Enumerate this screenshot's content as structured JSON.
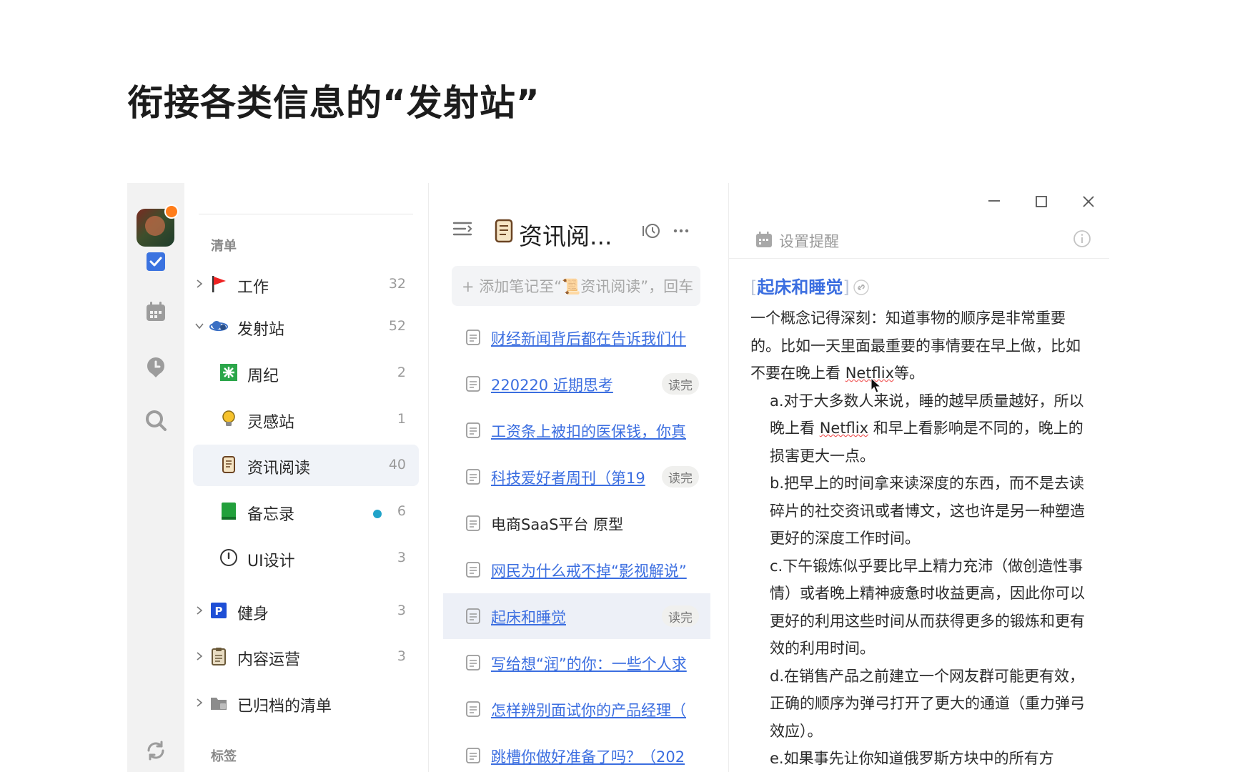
{
  "slide": {
    "title": "衔接各类信息的“发射站”"
  },
  "sidebar_rail": {
    "icons": [
      "checkbox-icon",
      "calendar-icon",
      "pin-icon",
      "search-icon",
      "sync-icon"
    ]
  },
  "lists": {
    "section_lists": "清单",
    "section_tags": "标签",
    "items": [
      {
        "label": "工作",
        "count": "32",
        "icon": "red-flag-icon"
      },
      {
        "label": "发射站",
        "count": "52",
        "icon": "planet-icon"
      },
      {
        "label": "周纪",
        "count": "2",
        "icon": "green-star-icon"
      },
      {
        "label": "灵感站",
        "count": "1",
        "icon": "bulb-icon"
      },
      {
        "label": "资讯阅读",
        "count": "40",
        "icon": "scroll-icon"
      },
      {
        "label": "备忘录",
        "count": "6",
        "icon": "green-book-icon"
      },
      {
        "label": "UI设计",
        "count": "3",
        "icon": "clock-icon"
      },
      {
        "label": "健身",
        "count": "3",
        "icon": "p-parking-icon"
      },
      {
        "label": "内容运营",
        "count": "3",
        "icon": "clipboard-icon"
      },
      {
        "label": "已归档的清单",
        "count": "",
        "icon": "archive-folder-icon"
      }
    ]
  },
  "notes": {
    "title": "资讯阅...",
    "add_placeholder": "+ 添加笔记至“📜资讯阅读”，回车",
    "items": [
      {
        "title": "财经新闻背后都在告诉我们什",
        "tag": "",
        "link": true
      },
      {
        "title": "220220 近期思考",
        "tag": "读完",
        "link": true
      },
      {
        "title": "工资条上被扣的医保钱，你真",
        "tag": "",
        "link": true
      },
      {
        "title": "科技爱好者周刊（第19",
        "tag": "读完",
        "link": true
      },
      {
        "title": "电商SaaS平台 原型",
        "tag": "",
        "link": false
      },
      {
        "title": "网民为什么戒不掉“影视解说”",
        "tag": "",
        "link": true
      },
      {
        "title": "起床和睡觉",
        "tag": "读完",
        "link": true
      },
      {
        "title": "写给想“润”的你：一些个人求",
        "tag": "",
        "link": true
      },
      {
        "title": "怎样辨别面试你的产品经理（",
        "tag": "",
        "link": true
      },
      {
        "title": "跳槽你做好准备了吗？（202",
        "tag": "",
        "link": true
      }
    ]
  },
  "detail": {
    "reminder_label": "设置提醒",
    "doc_title": "起床和睡觉",
    "bracket_open": "[",
    "bracket_close": "]",
    "paragraphs": [
      {
        "text_before": "一个概念记得深刻：知道事物的顺序是非常重要的。比如一天里面最重要的事情要在早上做，比如不要在晚上看 ",
        "emph": "Netflix",
        "text_after": "等。",
        "indent": false
      },
      {
        "text_before": "a.对于大多数人来说，睡的越早质量越好，所以晚上看 ",
        "emph": "Netflix",
        "text_after": " 和早上看影响是不同的，晚上的损害更大一点。",
        "indent": true
      },
      {
        "text_before": "b.把早上的时间拿来读深度的东西，而不是去读碎片的社交资讯或者博文，这也许是另一种塑造更好的深度工作时间。",
        "emph": "",
        "text_after": "",
        "indent": true
      },
      {
        "text_before": "c.下午锻炼似乎要比早上精力充沛（做创造性事情）或者晚上精神疲惫时收益更高，因此你可以更好的利用这些时间从而获得更多的锻炼和更有效的利用时间。",
        "emph": "",
        "text_after": "",
        "indent": true
      },
      {
        "text_before": "d.在销售产品之前建立一个网友群可能更有效，正确的顺序为弹弓打开了更大的通道（重力弹弓效应）。",
        "emph": "",
        "text_after": "",
        "indent": true
      },
      {
        "text_before": "e.如果事先让你知道俄罗斯方块中的所有方",
        "emph": "",
        "text_after": "",
        "indent": true
      }
    ]
  }
}
